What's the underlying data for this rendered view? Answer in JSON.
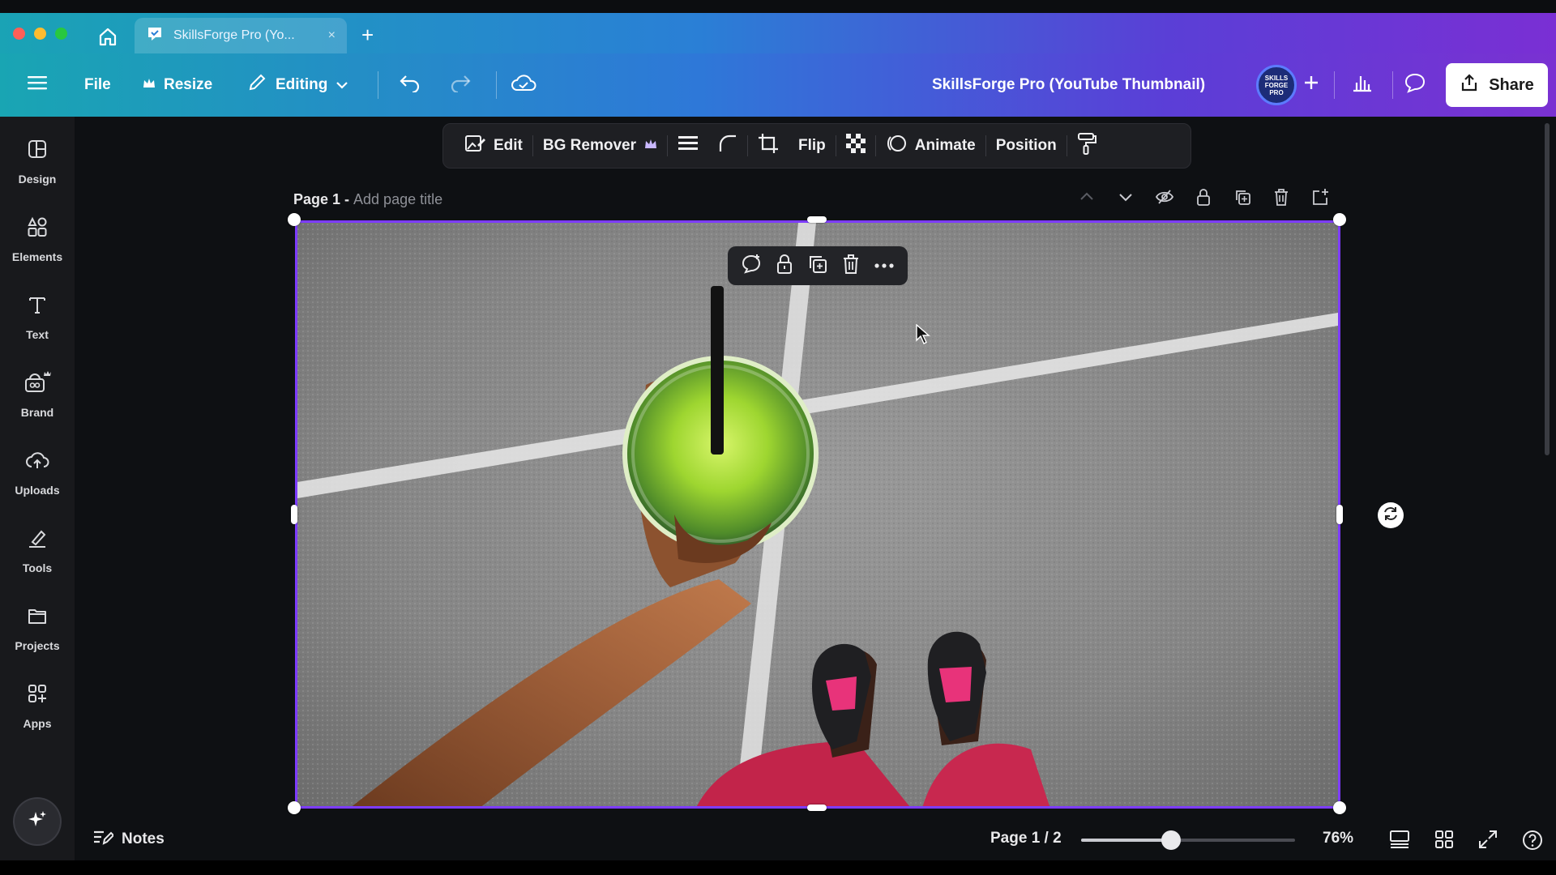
{
  "browser": {
    "tab_title": "SkillsForge Pro (Yo...",
    "tab_close": "×",
    "new_tab": "+"
  },
  "header": {
    "file_label": "File",
    "resize_label": "Resize",
    "editing_label": "Editing",
    "doc_title": "SkillsForge Pro (YouTube Thumbnail)",
    "avatar_text": [
      "SKILLS",
      "FORGE",
      "PRO"
    ],
    "share_label": "Share"
  },
  "sidebar": {
    "items": [
      {
        "label": "Design",
        "icon": "design-icon"
      },
      {
        "label": "Elements",
        "icon": "elements-icon"
      },
      {
        "label": "Text",
        "icon": "text-icon"
      },
      {
        "label": "Brand",
        "icon": "brand-icon"
      },
      {
        "label": "Uploads",
        "icon": "uploads-icon"
      },
      {
        "label": "Tools",
        "icon": "tools-icon"
      },
      {
        "label": "Projects",
        "icon": "projects-icon"
      },
      {
        "label": "Apps",
        "icon": "apps-icon"
      }
    ]
  },
  "toolbar": {
    "edit_label": "Edit",
    "bg_remover_label": "BG Remover",
    "flip_label": "Flip",
    "animate_label": "Animate",
    "position_label": "Position"
  },
  "page": {
    "label": "Page 1 - ",
    "title_placeholder": "Add page title"
  },
  "footer": {
    "notes_label": "Notes",
    "page_count": "Page 1 / 2",
    "zoom_value": "76%",
    "zoom_fraction": 0.42
  },
  "colors": {
    "selection": "#7d3cff",
    "accent_gradient_start": "#19a5b3",
    "accent_gradient_end": "#7a31d2"
  }
}
